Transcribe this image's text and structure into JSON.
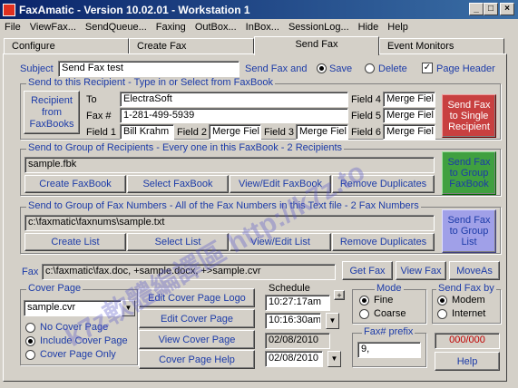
{
  "window": {
    "title": "FaxAmatic - Version 10.02.01 - Workstation 1"
  },
  "menu": [
    "File",
    "ViewFax...",
    "SendQueue...",
    "Faxing",
    "OutBox...",
    "InBox...",
    "SessionLog...",
    "Hide",
    "Help"
  ],
  "tabs": [
    "Configure",
    "Create Fax",
    "Send Fax",
    "Event Monitors"
  ],
  "subject": {
    "label": "Subject",
    "value": "Send Fax test",
    "send_and": "Send Fax and",
    "save": "Save",
    "delete": "Delete",
    "page_header": "Page Header"
  },
  "recipient": {
    "group_label": "Send to this Recipient - Type in or Select from FaxBook",
    "faxbook_btn": "Recipient from FaxBooks",
    "to_label": "To",
    "to": "ElectraSoft",
    "fax_label": "Fax #",
    "fax": "1-281-499-5939",
    "field1_label": "Field 1",
    "field1": "Bill Krahm",
    "field2_label": "Field 2",
    "field2": "Merge Fiel",
    "field3_label": "Field 3",
    "field3": "Merge Fiel",
    "field4_label": "Field 4",
    "field4": "Merge Fiel",
    "field5_label": "Field 5",
    "field5": "Merge Fiel",
    "field6_label": "Field 6",
    "field6": "Merge Fiel",
    "send_single": "Send Fax to Single Recipient"
  },
  "group": {
    "label": "Send to Group of Recipients - Every one in this FaxBook - 2 Recipients",
    "file": "sample.fbk",
    "create": "Create FaxBook",
    "select": "Select FaxBook",
    "view": "View/Edit FaxBook",
    "remove": "Remove Duplicates",
    "send": "Send Fax to Group FaxBook"
  },
  "numbers": {
    "label": "Send to Group of Fax Numbers - All of the Fax Numbers in this Text file - 2 Fax Numbers",
    "file": "c:\\faxmatic\\faxnums\\sample.txt",
    "create": "Create List",
    "select": "Select List",
    "view": "View/Edit List",
    "remove": "Remove Duplicates",
    "send": "Send Fax to Group List"
  },
  "fax": {
    "label": "Fax",
    "path": "c:\\faxmatic\\fax.doc, +sample.docx, +>sample.cvr",
    "get": "Get Fax",
    "view": "View Fax",
    "moveas": "MoveAs"
  },
  "cover": {
    "label": "Cover Page",
    "value": "sample.cvr",
    "no_cover": "No Cover Page",
    "include": "Include Cover Page",
    "only": "Cover Page Only",
    "edit_logo": "Edit Cover Page Logo",
    "edit": "Edit Cover Page",
    "view": "View Cover Page",
    "help": "Cover Page Help"
  },
  "schedule": {
    "label": "Schedule",
    "time1": "10:27:17am",
    "time2": "10:16:30am",
    "date1": "02/08/2010",
    "date2": "02/08/2010"
  },
  "mode": {
    "label": "Mode",
    "fine": "Fine",
    "coarse": "Coarse"
  },
  "sendby": {
    "label": "Send Fax by",
    "modem": "Modem",
    "internet": "Internet"
  },
  "prefix": {
    "label": "Fax# prefix",
    "value": "9,"
  },
  "counter": "000/000",
  "help": "Help",
  "watermark": [
    "k7z軟體編譯區 http://k7z.to"
  ],
  "colors": {
    "title_bar": "#0a246a",
    "accent": "#1c3ba8",
    "single_btn": "#c84040",
    "group_btn": "#40a040",
    "list_btn": "#a0a0e8"
  }
}
